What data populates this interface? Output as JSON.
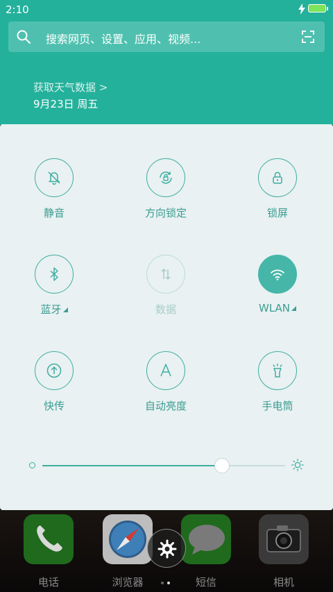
{
  "status_bar": {
    "time": "2:10"
  },
  "search": {
    "placeholder": "搜索网页、设置、应用、视频..."
  },
  "weather": {
    "link": "获取天气数据 >",
    "date": "9月23日 周五"
  },
  "toggles": [
    {
      "label": "静音",
      "icon": "bell-off-icon",
      "state": "off"
    },
    {
      "label": "方向锁定",
      "icon": "rotation-lock-icon",
      "state": "off"
    },
    {
      "label": "锁屏",
      "icon": "lock-icon",
      "state": "off"
    },
    {
      "label": "蓝牙",
      "icon": "bluetooth-icon",
      "state": "off",
      "has_more": true
    },
    {
      "label": "数据",
      "icon": "mobile-data-icon",
      "state": "disabled"
    },
    {
      "label": "WLAN",
      "icon": "wifi-icon",
      "state": "on",
      "has_more": true
    },
    {
      "label": "快传",
      "icon": "quick-transfer-icon",
      "state": "off"
    },
    {
      "label": "自动亮度",
      "icon": "auto-brightness-icon",
      "state": "off"
    },
    {
      "label": "手电筒",
      "icon": "flashlight-icon",
      "state": "off"
    }
  ],
  "brightness": {
    "level": 0.74
  },
  "dock": {
    "apps": [
      {
        "label": "电话",
        "icon": "phone-icon"
      },
      {
        "label": "浏览器",
        "icon": "browser-compass-icon"
      },
      {
        "label": "短信",
        "icon": "messages-icon"
      },
      {
        "label": "相机",
        "icon": "camera-icon"
      }
    ]
  },
  "colors": {
    "accent": "#3eada0",
    "header_bg": "#24b19c",
    "panel_bg": "#e9f1f2"
  }
}
